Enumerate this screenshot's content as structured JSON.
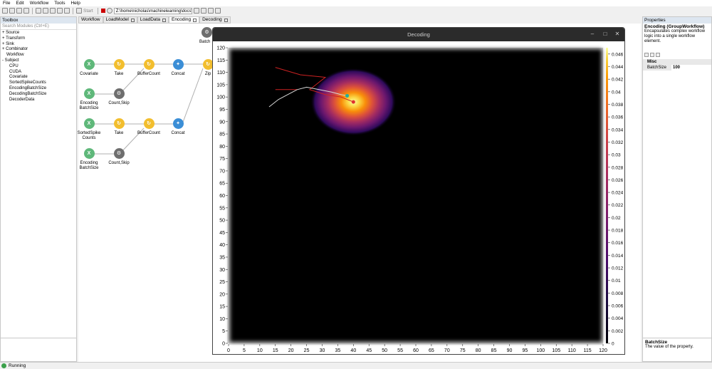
{
  "menu": [
    "File",
    "Edit",
    "Workflow",
    "Tools",
    "Help"
  ],
  "toolbar": {
    "start_label": "Start",
    "path": "Z:\\home\\nicholas\\machinelearning\\docs\\"
  },
  "toolbox": {
    "title": "Toolbox",
    "search_placeholder": "Search Modules (Ctrl+E)",
    "categories": [
      "+ Source",
      "+ Transform",
      "+ Sink",
      "+ Combinator",
      "Workflow",
      "- Subject"
    ],
    "subjects": [
      "CPU",
      "CUDA",
      "Covariate",
      "SortedSpikeCounts",
      "EncodingBatchSize",
      "DecodingBatchSize",
      "DecoderData"
    ]
  },
  "tabs": [
    {
      "label": "Workflow",
      "active": false,
      "closable": false
    },
    {
      "label": "LoadModel",
      "active": false,
      "closable": true
    },
    {
      "label": "LoadData",
      "active": false,
      "closable": true
    },
    {
      "label": "Encoding",
      "active": true,
      "closable": true
    },
    {
      "label": "Decoding",
      "active": false,
      "closable": true
    }
  ],
  "workflow": {
    "nodes": [
      {
        "id": "covariate",
        "label": "Covariate",
        "icon": "subscribe-icon",
        "color": "#5fb87a",
        "glyph": "X"
      },
      {
        "id": "take1",
        "label": "Take",
        "icon": "take-icon",
        "color": "#f2be2e",
        "glyph": "↻"
      },
      {
        "id": "buffercount1",
        "label": "BufferCount",
        "icon": "buffer-icon",
        "color": "#f2be2e",
        "glyph": "↻"
      },
      {
        "id": "concat1",
        "label": "Concat",
        "icon": "concat-icon",
        "color": "#3b8ed6",
        "glyph": "✦"
      },
      {
        "id": "zip",
        "label": "Zip",
        "icon": "zip-icon",
        "color": "#f2be2e",
        "glyph": "↻"
      },
      {
        "id": "encodingbatch1",
        "label": "Encoding\nBatchSize",
        "icon": "subscribe-icon",
        "color": "#5fb87a",
        "glyph": "X"
      },
      {
        "id": "countskip1",
        "label": "Count,Skip",
        "icon": "gear-icon",
        "color": "#6e6e6e",
        "glyph": "⚙"
      },
      {
        "id": "sortedspike",
        "label": "SortedSpike\nCounts",
        "icon": "subscribe-icon",
        "color": "#5fb87a",
        "glyph": "X"
      },
      {
        "id": "take2",
        "label": "Take",
        "icon": "take-icon",
        "color": "#f2be2e",
        "glyph": "↻"
      },
      {
        "id": "buffercount2",
        "label": "BufferCount",
        "icon": "buffer-icon",
        "color": "#f2be2e",
        "glyph": "↻"
      },
      {
        "id": "concat2",
        "label": "Concat",
        "icon": "concat-icon",
        "color": "#3b8ed6",
        "glyph": "✦"
      },
      {
        "id": "encodingbatch2",
        "label": "Encoding\nBatchSize",
        "icon": "subscribe-icon",
        "color": "#5fb87a",
        "glyph": "X"
      },
      {
        "id": "countskip2",
        "label": "Count,Skip",
        "icon": "gear-icon",
        "color": "#6e6e6e",
        "glyph": "⚙"
      },
      {
        "id": "batch",
        "label": "Batch",
        "icon": "gear-icon",
        "color": "#6e6e6e",
        "glyph": "⚙"
      }
    ]
  },
  "decoding_window": {
    "title": "Decoding",
    "controls": [
      "–",
      "□",
      "✕"
    ]
  },
  "chart_data": {
    "type": "heatmap",
    "title": "",
    "xlabel": "",
    "ylabel": "",
    "xlim": [
      0,
      120
    ],
    "ylim": [
      0,
      120
    ],
    "x_ticks": [
      0,
      5,
      10,
      15,
      20,
      25,
      30,
      35,
      40,
      45,
      50,
      55,
      60,
      65,
      70,
      75,
      80,
      85,
      90,
      95,
      100,
      105,
      110,
      115,
      120
    ],
    "y_ticks": [
      0,
      5,
      10,
      15,
      20,
      25,
      30,
      35,
      40,
      45,
      50,
      55,
      60,
      65,
      70,
      75,
      80,
      85,
      90,
      95,
      100,
      105,
      110,
      115,
      120
    ],
    "colorbar": {
      "colormap": "inferno",
      "range": [
        0,
        0.047
      ],
      "ticks": [
        "0",
        "0.002",
        "0.004",
        "0.006",
        "0.008",
        "0.01",
        "0.012",
        "0.014",
        "0.016",
        "0.018",
        "0.02",
        "0.022",
        "0.024",
        "0.026",
        "0.028",
        "0.03",
        "0.032",
        "0.034",
        "0.036",
        "0.038",
        "0.04",
        "0.042",
        "0.044",
        "0.046"
      ]
    },
    "posterior_peak": {
      "x": 40,
      "y": 98,
      "spread": 5.5,
      "max": 0.047
    },
    "true_trajectory_color": "#cc2222",
    "true_trajectory": [
      [
        15,
        112
      ],
      [
        23,
        109
      ],
      [
        31,
        108
      ],
      [
        26,
        103
      ],
      [
        31,
        101
      ],
      [
        36,
        100
      ],
      [
        40,
        98
      ]
    ],
    "red_branch": [
      [
        15,
        103
      ],
      [
        22,
        103
      ]
    ],
    "decoded_trajectory_color": "#d8d8d8",
    "decoded_trajectory": [
      [
        13,
        96
      ],
      [
        16,
        99
      ],
      [
        19,
        101
      ],
      [
        22,
        103
      ],
      [
        25,
        104
      ],
      [
        29,
        103
      ],
      [
        33,
        102
      ],
      [
        36,
        101
      ],
      [
        38,
        100.5
      ]
    ],
    "current_true_position": {
      "x": 40,
      "y": 98,
      "color": "#e03030"
    },
    "current_decoded_position": {
      "x": 38,
      "y": 100.5,
      "color": "#20b0a0"
    }
  },
  "properties": {
    "title": "Properties",
    "heading": "Encoding (GroupWorkflow)",
    "description": "Encapsulates complex workflow logic into a single workflow element.",
    "section": "Misc",
    "rows": [
      {
        "key": "BatchSize",
        "value": "100"
      }
    ],
    "help_title": "BatchSize",
    "help_text": "The value of the property."
  },
  "status": {
    "label": "Running"
  }
}
